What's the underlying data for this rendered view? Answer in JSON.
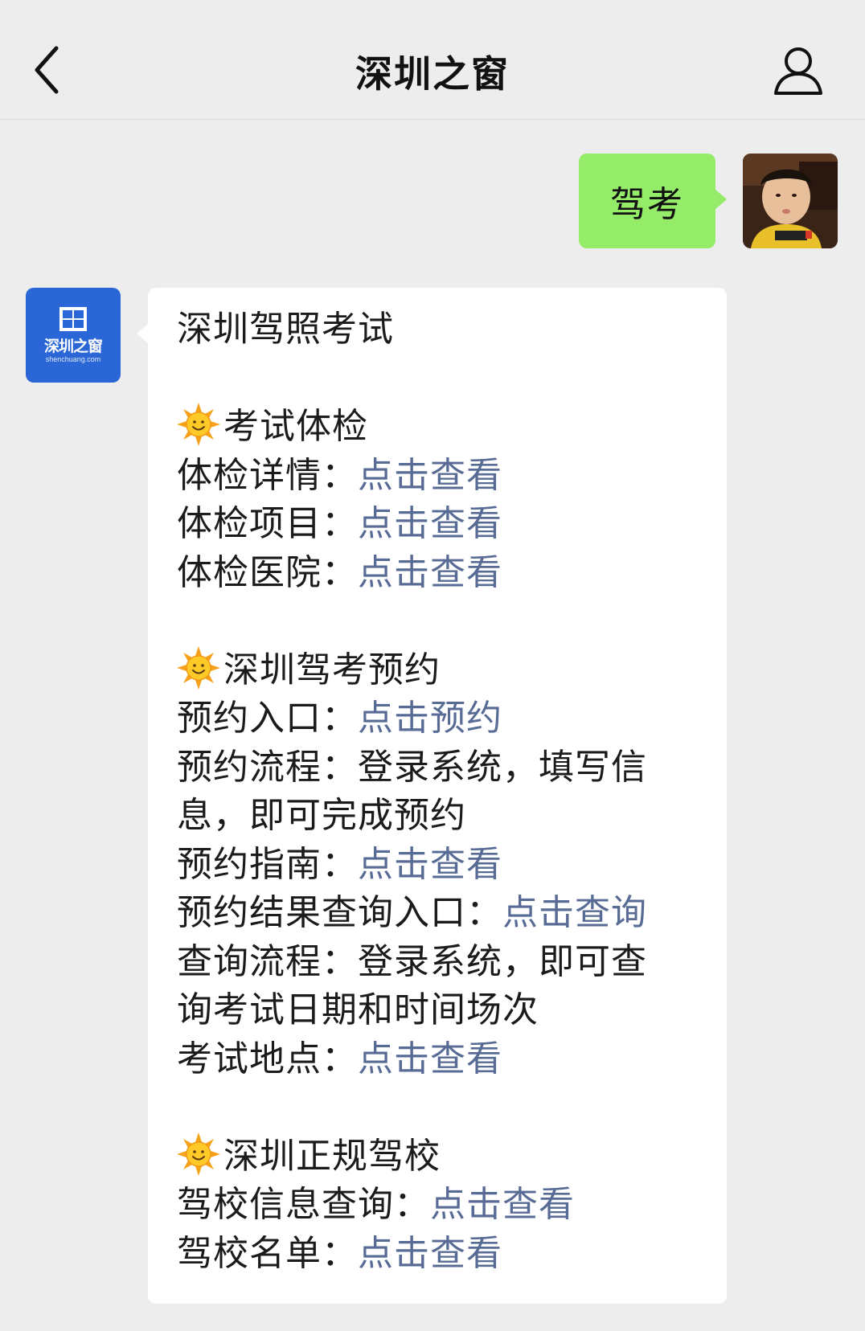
{
  "header": {
    "title": "深圳之窗"
  },
  "outgoing": {
    "text": "驾考"
  },
  "bot": {
    "avatar_logo": "深圳之窗",
    "avatar_sub": "shenchuang.com"
  },
  "message": {
    "title": "深圳驾照考试",
    "sections": [
      {
        "heading": "考试体检",
        "lines": [
          {
            "label": "体检详情：",
            "link": "点击查看"
          },
          {
            "label": "体检项目：",
            "link": "点击查看"
          },
          {
            "label": "体检医院：",
            "link": "点击查看"
          }
        ]
      },
      {
        "heading": "深圳驾考预约",
        "lines": [
          {
            "label": "预约入口：",
            "link": "点击预约"
          },
          {
            "text1": "预约流程：登录系统，填写信",
            "text2": "息，即可完成预约"
          },
          {
            "label": "预约指南：",
            "link": "点击查看"
          },
          {
            "label": "预约结果查询入口：",
            "link": "点击查询"
          },
          {
            "text1": "查询流程：登录系统，即可查",
            "text2": "询考试日期和时间场次"
          },
          {
            "label": "考试地点：",
            "link": "点击查看"
          }
        ]
      },
      {
        "heading": "深圳正规驾校",
        "lines": [
          {
            "label": "驾校信息查询：",
            "link": "点击查看"
          },
          {
            "label": "驾校名单：",
            "link": "点击查看"
          }
        ]
      }
    ]
  },
  "colors": {
    "link": "#576b95",
    "outgoing_bubble": "#95ec69",
    "background": "#ededed",
    "bot_avatar": "#2a66d6"
  },
  "icons": [
    "back-arrow-icon",
    "profile-icon",
    "sun-emoji-icon"
  ]
}
